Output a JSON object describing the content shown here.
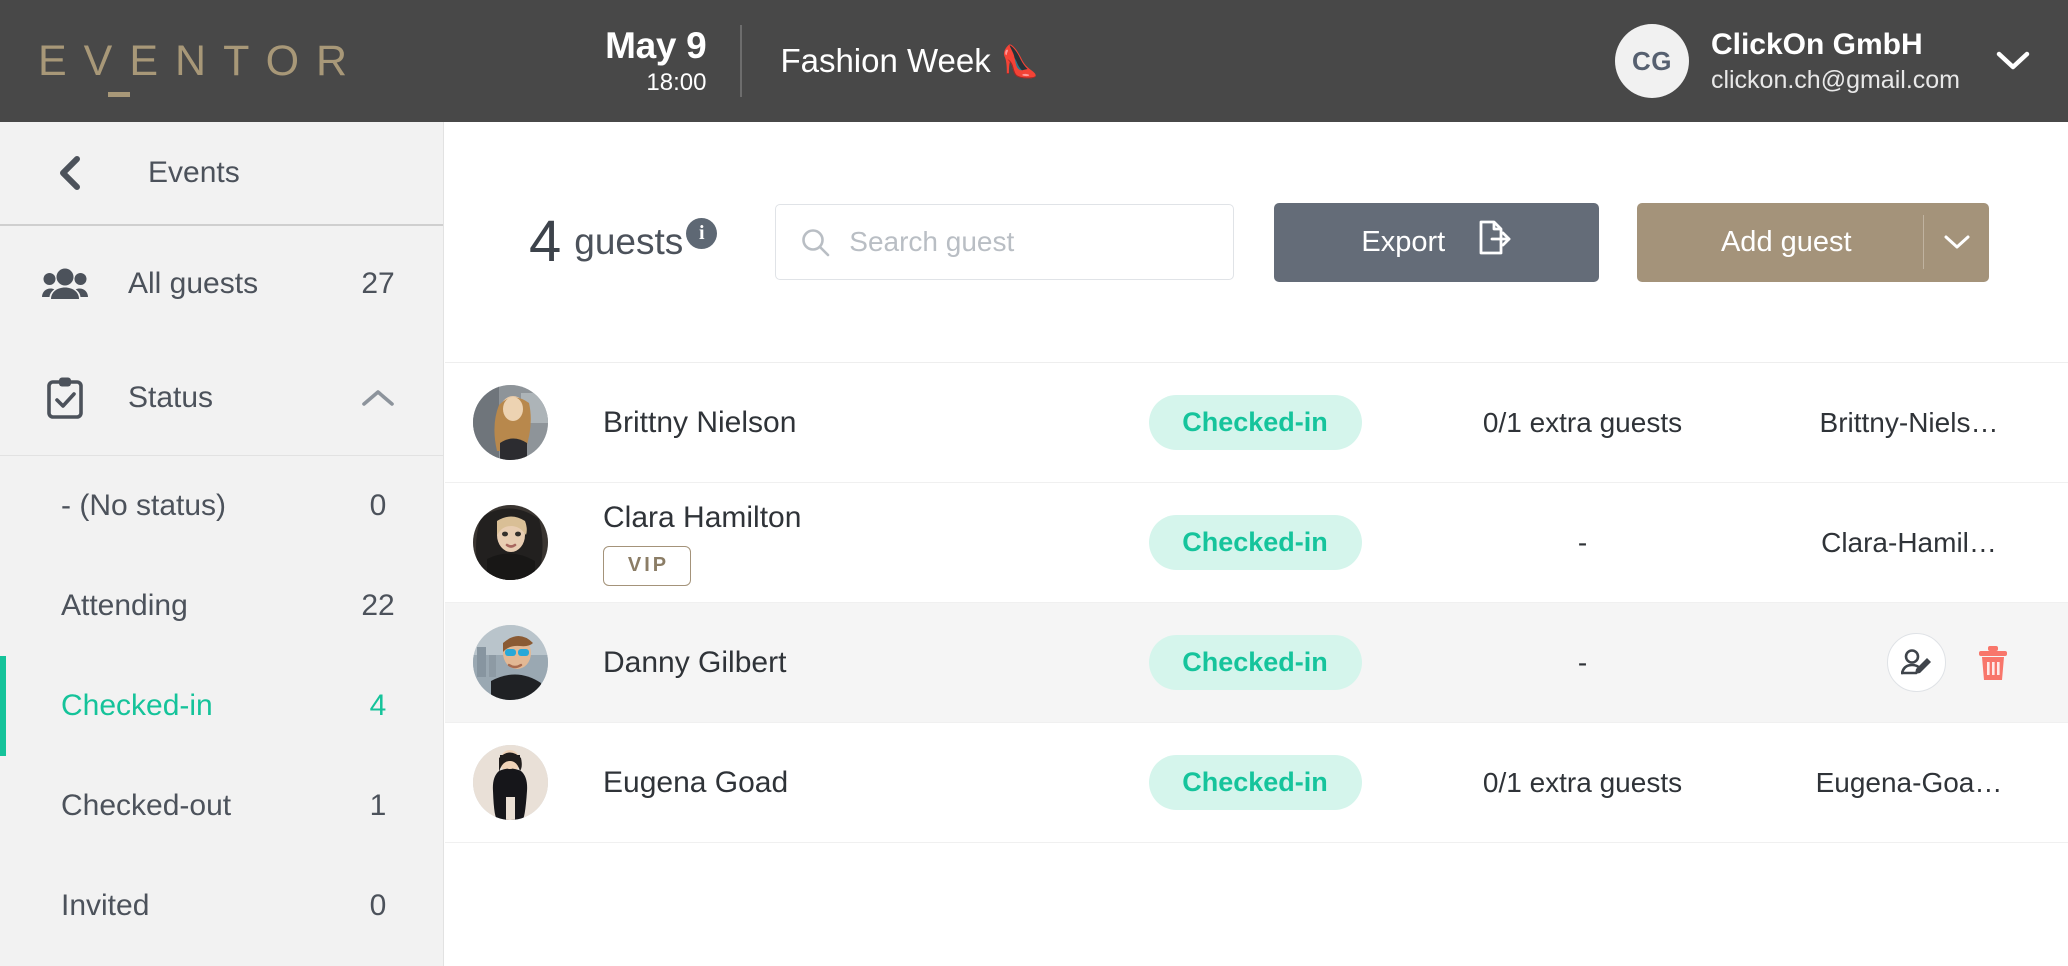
{
  "brand": {
    "logo": "EVENTOR",
    "accent": "#a4937a",
    "dark": "#484848",
    "green": "#15c39a"
  },
  "header": {
    "date_day": "May 9",
    "date_time": "18:00",
    "event_title": "Fashion Week",
    "event_emoji": "👠",
    "account": {
      "initials": "CG",
      "name": "ClickOn GmbH",
      "email": "clickon.ch@gmail.com",
      "chevron": "chevron-down-icon"
    }
  },
  "sidebar": {
    "back_label": "Events",
    "back_icon": "chevron-left-icon",
    "groups": [
      {
        "icon": "people-icon",
        "label": "All guests",
        "count": "27"
      },
      {
        "icon": "clipboard-check-icon",
        "label": "Status",
        "chevron": "chevron-up-icon"
      }
    ],
    "status_items": [
      {
        "label": "- (No status)",
        "count": "0",
        "active": false
      },
      {
        "label": "Attending",
        "count": "22",
        "active": false
      },
      {
        "label": "Checked-in",
        "count": "4",
        "active": true
      },
      {
        "label": "Checked-out",
        "count": "1",
        "active": false
      },
      {
        "label": "Invited",
        "count": "0",
        "active": false
      }
    ]
  },
  "toolbar": {
    "count_number": "4",
    "count_word": "guests",
    "info_icon": "info-icon",
    "info_glyph": "i",
    "search_placeholder": "Search guest",
    "search_value": "",
    "search_icon": "search-icon",
    "export_label": "Export",
    "export_icon": "export-file-icon",
    "add_guest_label": "Add guest",
    "add_guest_chevron": "chevron-down-icon"
  },
  "table": {
    "rows": [
      {
        "name": "Brittny Nielson",
        "vip": "",
        "status": "Checked-in",
        "extra": "0/1 extra guests",
        "reference": "Brittny-Niels…",
        "hovered": false,
        "avatar": "photo-woman-blonde"
      },
      {
        "name": "Clara Hamilton",
        "vip": "VIP",
        "status": "Checked-in",
        "extra": "-",
        "reference": "Clara-Hamil…",
        "hovered": false,
        "avatar": "photo-woman-fur"
      },
      {
        "name": "Danny Gilbert",
        "vip": "",
        "status": "Checked-in",
        "extra": "-",
        "reference": "",
        "hovered": true,
        "avatar": "photo-man-sunglasses",
        "actions": [
          {
            "icon": "edit-guest-icon"
          },
          {
            "icon": "trash-icon",
            "color": "#f8766b"
          }
        ]
      },
      {
        "name": "Eugena Goad",
        "vip": "",
        "status": "Checked-in",
        "extra": "0/1 extra guests",
        "reference": "Eugena-Goa…",
        "hovered": false,
        "avatar": "photo-woman-blackdress"
      }
    ]
  }
}
